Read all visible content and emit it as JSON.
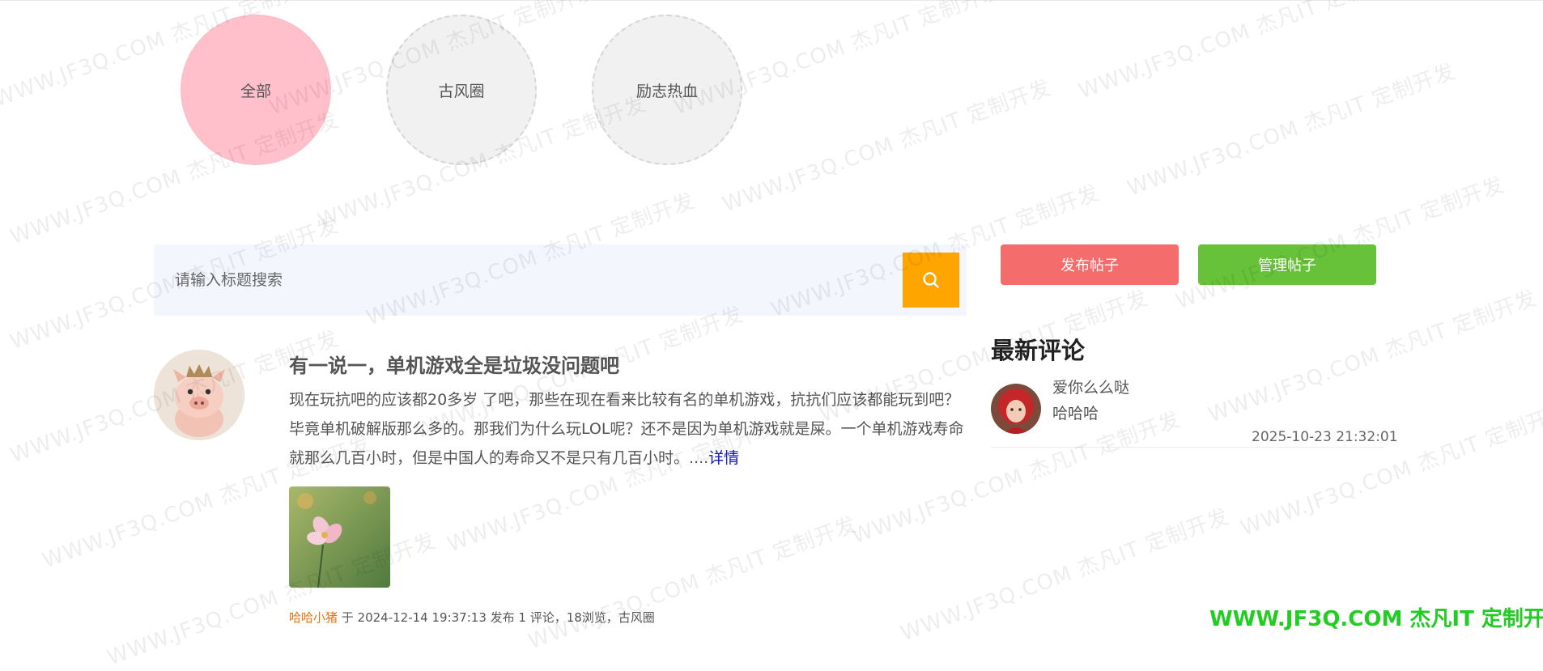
{
  "categories": [
    {
      "label": "全部",
      "active": true
    },
    {
      "label": "古风圈",
      "active": false
    },
    {
      "label": "励志热血",
      "active": false
    }
  ],
  "search": {
    "placeholder": "请输入标题搜索",
    "icon": "search-icon"
  },
  "actions": {
    "publish_label": "发布帖子",
    "manage_label": "管理帖子",
    "publish_color": "#f56c6c",
    "manage_color": "#67c23a"
  },
  "post": {
    "title": "有一说一，单机游戏全是垃圾没问题吧",
    "body": "现在玩抗吧的应该都20多岁 了吧，那些在现在看来比较有名的单机游戏，抗抗们应该都能玩到吧？毕竟单机破解版那么多的。那我们为什么玩LOL呢？还不是因为单机游戏就是屎。一个单机游戏寿命就那么几百小时，但是中国人的寿命又不是只有几百小时。....",
    "detail_link": "详情",
    "author": "哈哈小猪",
    "meta_rest": " 于 2024-12-14 19:37:13 发布 1 评论，18浏览，古风圈"
  },
  "latest_comments": {
    "title": "最新评论",
    "items": [
      {
        "user": "爱你么么哒",
        "text": "哈哈哈",
        "time": "2025-10-23 21:32:01"
      }
    ]
  },
  "watermark": {
    "text": "WWW.JF3Q.COM 杰凡IT 定制开发",
    "brand": "WWW.JF3Q.COM 杰凡IT  定制开发"
  }
}
